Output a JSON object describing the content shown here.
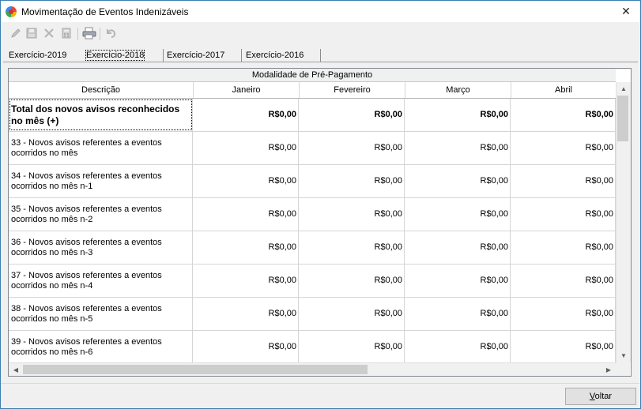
{
  "window": {
    "title": "Movimentação de Eventos Indenizáveis",
    "close_glyph": "✕"
  },
  "toolbar": {
    "icons": [
      "pencil-icon",
      "save-icon",
      "delete-icon",
      "calculator-icon",
      "print-icon",
      "undo-icon"
    ]
  },
  "tabs": [
    {
      "label": "Exercício-2019",
      "active": false
    },
    {
      "label": "Exercício-2018",
      "active": true
    },
    {
      "label": "Exercício-2017",
      "active": false
    },
    {
      "label": "Exercício-2016",
      "active": false
    }
  ],
  "grid": {
    "band_title": "Modalidade de Pré-Pagamento",
    "columns": [
      "Descrição",
      "Janeiro",
      "Fevereiro",
      "Março",
      "Abril"
    ],
    "rows": [
      {
        "desc": "Total dos novos avisos reconhecidos no mês (+)",
        "values": [
          "R$0,00",
          "R$0,00",
          "R$0,00",
          "R$0,00"
        ],
        "total": true
      },
      {
        "desc": "33 - Novos avisos referentes a eventos ocorridos no mês",
        "values": [
          "R$0,00",
          "R$0,00",
          "R$0,00",
          "R$0,00"
        ]
      },
      {
        "desc": "34 - Novos avisos referentes a eventos ocorridos no mês n-1",
        "values": [
          "R$0,00",
          "R$0,00",
          "R$0,00",
          "R$0,00"
        ]
      },
      {
        "desc": "35 - Novos avisos referentes a eventos ocorridos no mês n-2",
        "values": [
          "R$0,00",
          "R$0,00",
          "R$0,00",
          "R$0,00"
        ]
      },
      {
        "desc": "36 - Novos avisos referentes a eventos ocorridos no mês n-3",
        "values": [
          "R$0,00",
          "R$0,00",
          "R$0,00",
          "R$0,00"
        ]
      },
      {
        "desc": "37 - Novos avisos referentes a eventos ocorridos no mês n-4",
        "values": [
          "R$0,00",
          "R$0,00",
          "R$0,00",
          "R$0,00"
        ]
      },
      {
        "desc": "38 - Novos avisos referentes a eventos ocorridos no mês n-5",
        "values": [
          "R$0,00",
          "R$0,00",
          "R$0,00",
          "R$0,00"
        ]
      },
      {
        "desc": "39 - Novos avisos referentes a eventos ocorridos no mês n-6",
        "values": [
          "R$0,00",
          "R$0,00",
          "R$0,00",
          "R$0,00"
        ]
      }
    ]
  },
  "footer": {
    "voltar_accel": "V",
    "voltar_rest": "oltar"
  },
  "colors": {
    "frame_border": "#3c7fb1",
    "window_bg": "#f0f0f0",
    "grid_bg": "#ffffff"
  }
}
